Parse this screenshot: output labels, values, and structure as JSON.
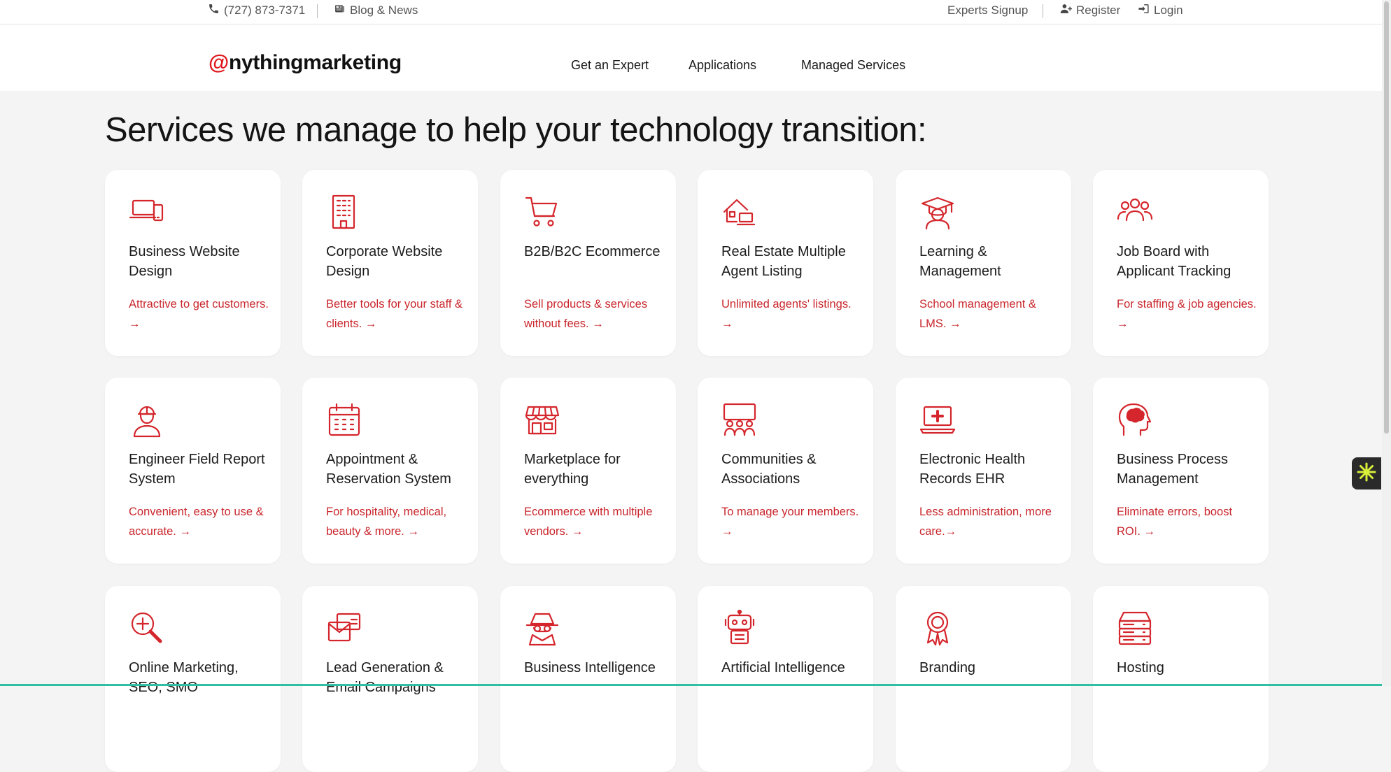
{
  "topbar": {
    "phone": "(727) 873-7371",
    "blog": "Blog & News",
    "experts": "Experts Signup",
    "register": "Register",
    "login": "Login"
  },
  "header": {
    "logo_at": "@",
    "logo_text": "nythingmarketing",
    "nav": [
      "Get an Expert",
      "Applications",
      "Managed Services"
    ]
  },
  "main": {
    "heading": "Services we manage to help your technology transition:",
    "cards": [
      {
        "icon": "laptop-phone-icon",
        "title": "Business Website Design",
        "desc": "Attractive to get customers. →"
      },
      {
        "icon": "building-icon",
        "title": "Corporate Website Design",
        "desc": "Better tools for your staff & clients. →"
      },
      {
        "icon": "cart-icon",
        "title": "B2B/B2C Ecommerce",
        "desc": "Sell products & services without fees. →"
      },
      {
        "icon": "house-laptop-icon",
        "title": "Real Estate Multiple Agent Listing",
        "desc": "Unlimited agents' listings. →"
      },
      {
        "icon": "graduate-icon",
        "title": "Learning & Management",
        "desc": "School management & LMS. →"
      },
      {
        "icon": "people-group-icon",
        "title": "Job Board with Applicant Tracking",
        "desc": "For staffing & job agencies. →"
      },
      {
        "icon": "engineer-icon",
        "title": "Engineer Field Report System",
        "desc": "Convenient, easy to use & accurate. →"
      },
      {
        "icon": "calendar-icon",
        "title": "Appointment & Reservation System",
        "desc": "For hospitality, medical, beauty & more. →"
      },
      {
        "icon": "store-icon",
        "title": "Marketplace for everything",
        "desc": "Ecommerce with multiple vendors. →"
      },
      {
        "icon": "community-icon",
        "title": "Communities & Associations",
        "desc": "To manage your members. →"
      },
      {
        "icon": "laptop-medical-icon",
        "title": "Electronic Health Records EHR",
        "desc": "Less administration, more care.→"
      },
      {
        "icon": "brain-head-icon",
        "title": "Business Process Management",
        "desc": "Eliminate errors, boost ROI. →"
      },
      {
        "icon": "magnifier-plus-icon",
        "title": "Online Marketing, SEO, SMO",
        "desc": ""
      },
      {
        "icon": "mail-card-icon",
        "title": "Lead Generation & Email Campaigns",
        "desc": ""
      },
      {
        "icon": "spy-icon",
        "title": "Business Intelligence",
        "desc": ""
      },
      {
        "icon": "robot-icon",
        "title": "Artificial Intelligence",
        "desc": ""
      },
      {
        "icon": "award-icon",
        "title": "Branding",
        "desc": ""
      },
      {
        "icon": "server-icon",
        "title": "Hosting",
        "desc": ""
      }
    ]
  },
  "colors": {
    "accent": "#d4262c",
    "background": "#f4f4f4",
    "card": "#ffffff",
    "widget": "#2a2a2a"
  }
}
